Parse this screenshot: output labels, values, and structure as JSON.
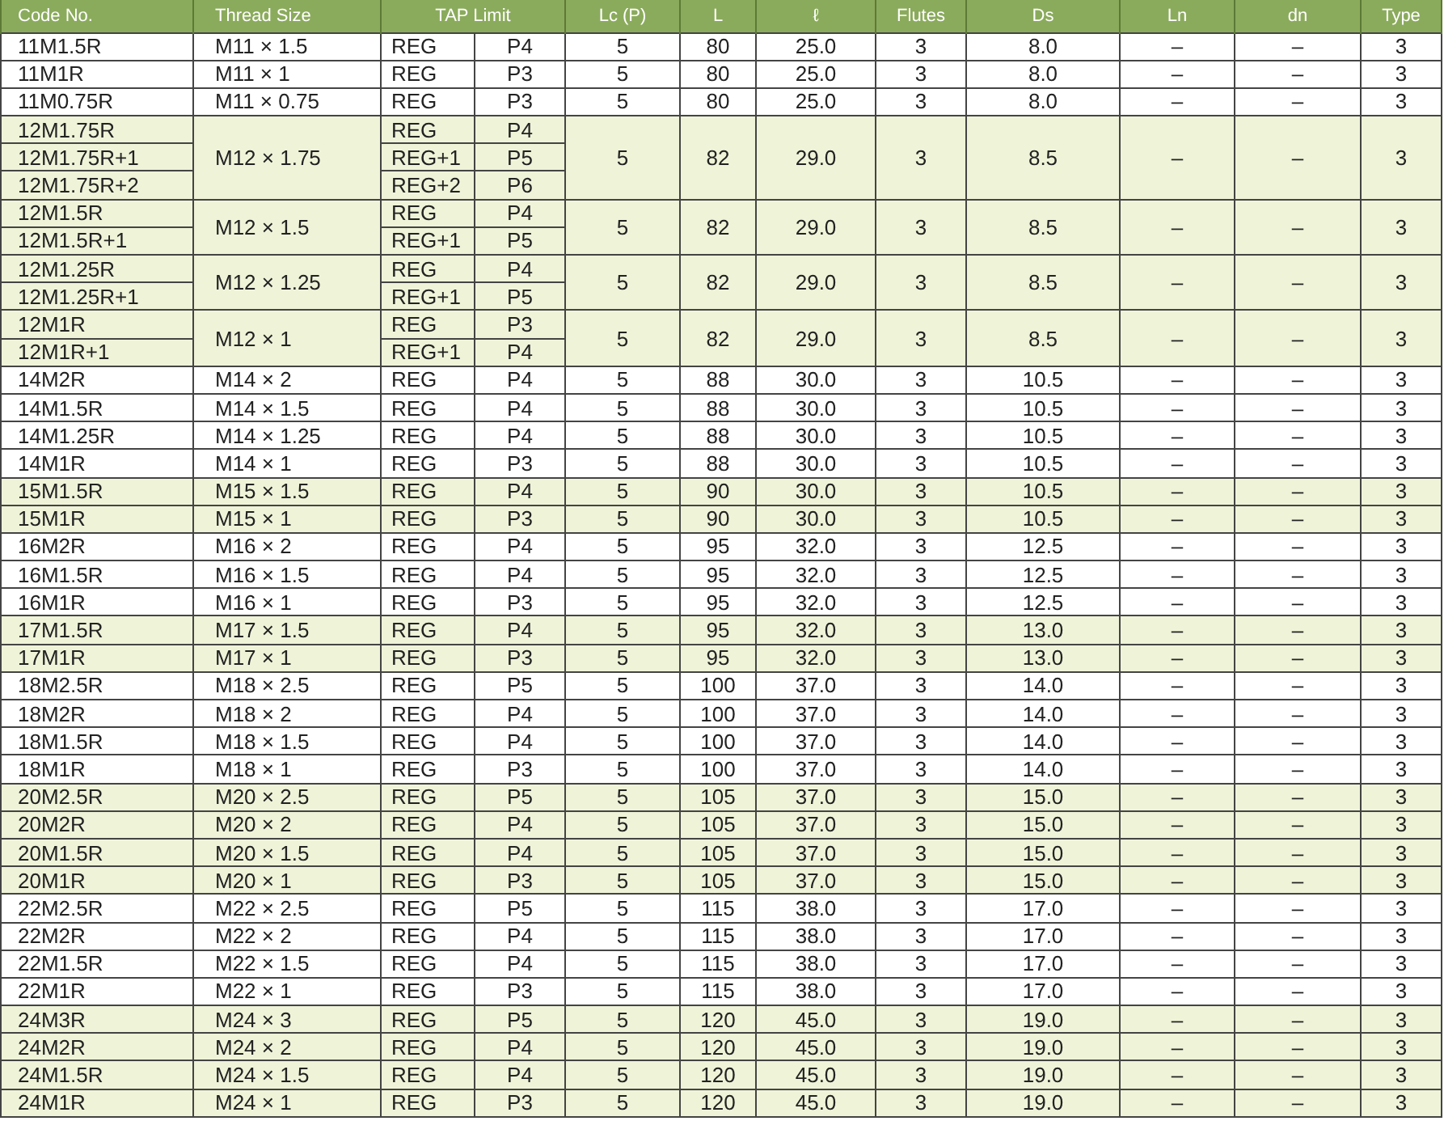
{
  "table": {
    "columns": [
      "Code No.",
      "Thread Size",
      "TAP Limit",
      "Lc (P)",
      "L",
      "ℓ",
      "Flutes",
      "Ds",
      "Ln",
      "dn",
      "Type"
    ],
    "groups": [
      {
        "shaded": false,
        "thread": "M11 × 1.5",
        "lc": "5",
        "l": "80",
        "ell": "25.0",
        "flutes": "3",
        "ds": "8.0",
        "ln": "–",
        "dn": "–",
        "type": "3",
        "items": [
          {
            "code": "11M1.5R",
            "tap": "REG",
            "p": "P4"
          }
        ]
      },
      {
        "shaded": false,
        "thread": "M11 × 1",
        "lc": "5",
        "l": "80",
        "ell": "25.0",
        "flutes": "3",
        "ds": "8.0",
        "ln": "–",
        "dn": "–",
        "type": "3",
        "items": [
          {
            "code": "11M1R",
            "tap": "REG",
            "p": "P3"
          }
        ]
      },
      {
        "shaded": false,
        "thread": "M11 × 0.75",
        "lc": "5",
        "l": "80",
        "ell": "25.0",
        "flutes": "3",
        "ds": "8.0",
        "ln": "–",
        "dn": "–",
        "type": "3",
        "items": [
          {
            "code": "11M0.75R",
            "tap": "REG",
            "p": "P3"
          }
        ]
      },
      {
        "shaded": true,
        "thread": "M12 × 1.75",
        "lc": "5",
        "l": "82",
        "ell": "29.0",
        "flutes": "3",
        "ds": "8.5",
        "ln": "–",
        "dn": "–",
        "type": "3",
        "items": [
          {
            "code": "12M1.75R",
            "tap": "REG",
            "p": "P4"
          },
          {
            "code": "12M1.75R+1",
            "tap": "REG+1",
            "p": "P5"
          },
          {
            "code": "12M1.75R+2",
            "tap": "REG+2",
            "p": "P6"
          }
        ]
      },
      {
        "shaded": true,
        "thread": "M12 × 1.5",
        "lc": "5",
        "l": "82",
        "ell": "29.0",
        "flutes": "3",
        "ds": "8.5",
        "ln": "–",
        "dn": "–",
        "type": "3",
        "items": [
          {
            "code": "12M1.5R",
            "tap": "REG",
            "p": "P4"
          },
          {
            "code": "12M1.5R+1",
            "tap": "REG+1",
            "p": "P5"
          }
        ]
      },
      {
        "shaded": true,
        "thread": "M12 × 1.25",
        "lc": "5",
        "l": "82",
        "ell": "29.0",
        "flutes": "3",
        "ds": "8.5",
        "ln": "–",
        "dn": "–",
        "type": "3",
        "items": [
          {
            "code": "12M1.25R",
            "tap": "REG",
            "p": "P4"
          },
          {
            "code": "12M1.25R+1",
            "tap": "REG+1",
            "p": "P5"
          }
        ]
      },
      {
        "shaded": true,
        "thread": "M12 × 1",
        "lc": "5",
        "l": "82",
        "ell": "29.0",
        "flutes": "3",
        "ds": "8.5",
        "ln": "–",
        "dn": "–",
        "type": "3",
        "items": [
          {
            "code": "12M1R",
            "tap": "REG",
            "p": "P3"
          },
          {
            "code": "12M1R+1",
            "tap": "REG+1",
            "p": "P4"
          }
        ]
      },
      {
        "shaded": false,
        "thread": "M14 × 2",
        "lc": "5",
        "l": "88",
        "ell": "30.0",
        "flutes": "3",
        "ds": "10.5",
        "ln": "–",
        "dn": "–",
        "type": "3",
        "items": [
          {
            "code": "14M2R",
            "tap": "REG",
            "p": "P4"
          }
        ]
      },
      {
        "shaded": false,
        "thread": "M14 × 1.5",
        "lc": "5",
        "l": "88",
        "ell": "30.0",
        "flutes": "3",
        "ds": "10.5",
        "ln": "–",
        "dn": "–",
        "type": "3",
        "items": [
          {
            "code": "14M1.5R",
            "tap": "REG",
            "p": "P4"
          }
        ]
      },
      {
        "shaded": false,
        "thread": "M14 × 1.25",
        "lc": "5",
        "l": "88",
        "ell": "30.0",
        "flutes": "3",
        "ds": "10.5",
        "ln": "–",
        "dn": "–",
        "type": "3",
        "items": [
          {
            "code": "14M1.25R",
            "tap": "REG",
            "p": "P4"
          }
        ]
      },
      {
        "shaded": false,
        "thread": "M14 × 1",
        "lc": "5",
        "l": "88",
        "ell": "30.0",
        "flutes": "3",
        "ds": "10.5",
        "ln": "–",
        "dn": "–",
        "type": "3",
        "items": [
          {
            "code": "14M1R",
            "tap": "REG",
            "p": "P3"
          }
        ]
      },
      {
        "shaded": true,
        "thread": "M15 × 1.5",
        "lc": "5",
        "l": "90",
        "ell": "30.0",
        "flutes": "3",
        "ds": "10.5",
        "ln": "–",
        "dn": "–",
        "type": "3",
        "items": [
          {
            "code": "15M1.5R",
            "tap": "REG",
            "p": "P4"
          }
        ]
      },
      {
        "shaded": true,
        "thread": "M15 × 1",
        "lc": "5",
        "l": "90",
        "ell": "30.0",
        "flutes": "3",
        "ds": "10.5",
        "ln": "–",
        "dn": "–",
        "type": "3",
        "items": [
          {
            "code": "15M1R",
            "tap": "REG",
            "p": "P3"
          }
        ]
      },
      {
        "shaded": false,
        "thread": "M16 × 2",
        "lc": "5",
        "l": "95",
        "ell": "32.0",
        "flutes": "3",
        "ds": "12.5",
        "ln": "–",
        "dn": "–",
        "type": "3",
        "items": [
          {
            "code": "16M2R",
            "tap": "REG",
            "p": "P4"
          }
        ]
      },
      {
        "shaded": false,
        "thread": "M16 × 1.5",
        "lc": "5",
        "l": "95",
        "ell": "32.0",
        "flutes": "3",
        "ds": "12.5",
        "ln": "–",
        "dn": "–",
        "type": "3",
        "items": [
          {
            "code": "16M1.5R",
            "tap": "REG",
            "p": "P4"
          }
        ]
      },
      {
        "shaded": false,
        "thread": "M16 × 1",
        "lc": "5",
        "l": "95",
        "ell": "32.0",
        "flutes": "3",
        "ds": "12.5",
        "ln": "–",
        "dn": "–",
        "type": "3",
        "items": [
          {
            "code": "16M1R",
            "tap": "REG",
            "p": "P3"
          }
        ]
      },
      {
        "shaded": true,
        "thread": "M17 × 1.5",
        "lc": "5",
        "l": "95",
        "ell": "32.0",
        "flutes": "3",
        "ds": "13.0",
        "ln": "–",
        "dn": "–",
        "type": "3",
        "items": [
          {
            "code": "17M1.5R",
            "tap": "REG",
            "p": "P4"
          }
        ]
      },
      {
        "shaded": true,
        "thread": "M17 × 1",
        "lc": "5",
        "l": "95",
        "ell": "32.0",
        "flutes": "3",
        "ds": "13.0",
        "ln": "–",
        "dn": "–",
        "type": "3",
        "items": [
          {
            "code": "17M1R",
            "tap": "REG",
            "p": "P3"
          }
        ]
      },
      {
        "shaded": false,
        "thread": "M18 × 2.5",
        "lc": "5",
        "l": "100",
        "ell": "37.0",
        "flutes": "3",
        "ds": "14.0",
        "ln": "–",
        "dn": "–",
        "type": "3",
        "items": [
          {
            "code": "18M2.5R",
            "tap": "REG",
            "p": "P5"
          }
        ]
      },
      {
        "shaded": false,
        "thread": "M18 × 2",
        "lc": "5",
        "l": "100",
        "ell": "37.0",
        "flutes": "3",
        "ds": "14.0",
        "ln": "–",
        "dn": "–",
        "type": "3",
        "items": [
          {
            "code": "18M2R",
            "tap": "REG",
            "p": "P4"
          }
        ]
      },
      {
        "shaded": false,
        "thread": "M18 × 1.5",
        "lc": "5",
        "l": "100",
        "ell": "37.0",
        "flutes": "3",
        "ds": "14.0",
        "ln": "–",
        "dn": "–",
        "type": "3",
        "items": [
          {
            "code": "18M1.5R",
            "tap": "REG",
            "p": "P4"
          }
        ]
      },
      {
        "shaded": false,
        "thread": "M18 × 1",
        "lc": "5",
        "l": "100",
        "ell": "37.0",
        "flutes": "3",
        "ds": "14.0",
        "ln": "–",
        "dn": "–",
        "type": "3",
        "items": [
          {
            "code": "18M1R",
            "tap": "REG",
            "p": "P3"
          }
        ]
      },
      {
        "shaded": true,
        "thread": "M20 × 2.5",
        "lc": "5",
        "l": "105",
        "ell": "37.0",
        "flutes": "3",
        "ds": "15.0",
        "ln": "–",
        "dn": "–",
        "type": "3",
        "items": [
          {
            "code": "20M2.5R",
            "tap": "REG",
            "p": "P5"
          }
        ]
      },
      {
        "shaded": true,
        "thread": "M20 × 2",
        "lc": "5",
        "l": "105",
        "ell": "37.0",
        "flutes": "3",
        "ds": "15.0",
        "ln": "–",
        "dn": "–",
        "type": "3",
        "items": [
          {
            "code": "20M2R",
            "tap": "REG",
            "p": "P4"
          }
        ]
      },
      {
        "shaded": true,
        "thread": "M20 × 1.5",
        "lc": "5",
        "l": "105",
        "ell": "37.0",
        "flutes": "3",
        "ds": "15.0",
        "ln": "–",
        "dn": "–",
        "type": "3",
        "items": [
          {
            "code": "20M1.5R",
            "tap": "REG",
            "p": "P4"
          }
        ]
      },
      {
        "shaded": true,
        "thread": "M20 × 1",
        "lc": "5",
        "l": "105",
        "ell": "37.0",
        "flutes": "3",
        "ds": "15.0",
        "ln": "–",
        "dn": "–",
        "type": "3",
        "items": [
          {
            "code": "20M1R",
            "tap": "REG",
            "p": "P3"
          }
        ]
      },
      {
        "shaded": false,
        "thread": "M22 × 2.5",
        "lc": "5",
        "l": "115",
        "ell": "38.0",
        "flutes": "3",
        "ds": "17.0",
        "ln": "–",
        "dn": "–",
        "type": "3",
        "items": [
          {
            "code": "22M2.5R",
            "tap": "REG",
            "p": "P5"
          }
        ]
      },
      {
        "shaded": false,
        "thread": "M22 × 2",
        "lc": "5",
        "l": "115",
        "ell": "38.0",
        "flutes": "3",
        "ds": "17.0",
        "ln": "–",
        "dn": "–",
        "type": "3",
        "items": [
          {
            "code": "22M2R",
            "tap": "REG",
            "p": "P4"
          }
        ]
      },
      {
        "shaded": false,
        "thread": "M22 × 1.5",
        "lc": "5",
        "l": "115",
        "ell": "38.0",
        "flutes": "3",
        "ds": "17.0",
        "ln": "–",
        "dn": "–",
        "type": "3",
        "items": [
          {
            "code": "22M1.5R",
            "tap": "REG",
            "p": "P4"
          }
        ]
      },
      {
        "shaded": false,
        "thread": "M22 × 1",
        "lc": "5",
        "l": "115",
        "ell": "38.0",
        "flutes": "3",
        "ds": "17.0",
        "ln": "–",
        "dn": "–",
        "type": "3",
        "items": [
          {
            "code": "22M1R",
            "tap": "REG",
            "p": "P3"
          }
        ]
      },
      {
        "shaded": true,
        "thread": "M24 × 3",
        "lc": "5",
        "l": "120",
        "ell": "45.0",
        "flutes": "3",
        "ds": "19.0",
        "ln": "–",
        "dn": "–",
        "type": "3",
        "items": [
          {
            "code": "24M3R",
            "tap": "REG",
            "p": "P5"
          }
        ]
      },
      {
        "shaded": true,
        "thread": "M24 × 2",
        "lc": "5",
        "l": "120",
        "ell": "45.0",
        "flutes": "3",
        "ds": "19.0",
        "ln": "–",
        "dn": "–",
        "type": "3",
        "items": [
          {
            "code": "24M2R",
            "tap": "REG",
            "p": "P4"
          }
        ]
      },
      {
        "shaded": true,
        "thread": "M24 × 1.5",
        "lc": "5",
        "l": "120",
        "ell": "45.0",
        "flutes": "3",
        "ds": "19.0",
        "ln": "–",
        "dn": "–",
        "type": "3",
        "items": [
          {
            "code": "24M1.5R",
            "tap": "REG",
            "p": "P4"
          }
        ]
      },
      {
        "shaded": true,
        "thread": "M24 × 1",
        "lc": "5",
        "l": "120",
        "ell": "45.0",
        "flutes": "3",
        "ds": "19.0",
        "ln": "–",
        "dn": "–",
        "type": "3",
        "items": [
          {
            "code": "24M1R",
            "tap": "REG",
            "p": "P3"
          }
        ]
      }
    ]
  }
}
